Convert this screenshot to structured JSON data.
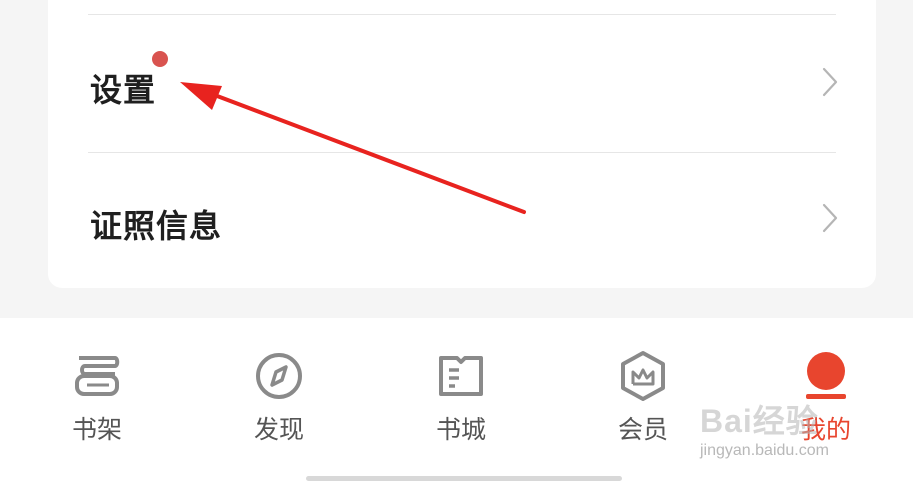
{
  "menu": {
    "items": [
      {
        "label": "设置",
        "has_badge": true
      },
      {
        "label": "证照信息",
        "has_badge": false
      }
    ]
  },
  "tabbar": {
    "tabs": [
      {
        "label": "书架",
        "icon": "bookshelf-icon",
        "active": false
      },
      {
        "label": "发现",
        "icon": "compass-icon",
        "active": false
      },
      {
        "label": "书城",
        "icon": "book-store-icon",
        "active": false
      },
      {
        "label": "会员",
        "icon": "crown-hexagon-icon",
        "active": false
      },
      {
        "label": "我的",
        "icon": "profile-avatar-icon",
        "active": true
      }
    ]
  },
  "watermark": {
    "brand": "Bai经验",
    "url": "jingyan.baidu.com"
  },
  "colors": {
    "accent": "#e8452e",
    "badge": "#d9534f",
    "arrow": "#e8231f"
  }
}
